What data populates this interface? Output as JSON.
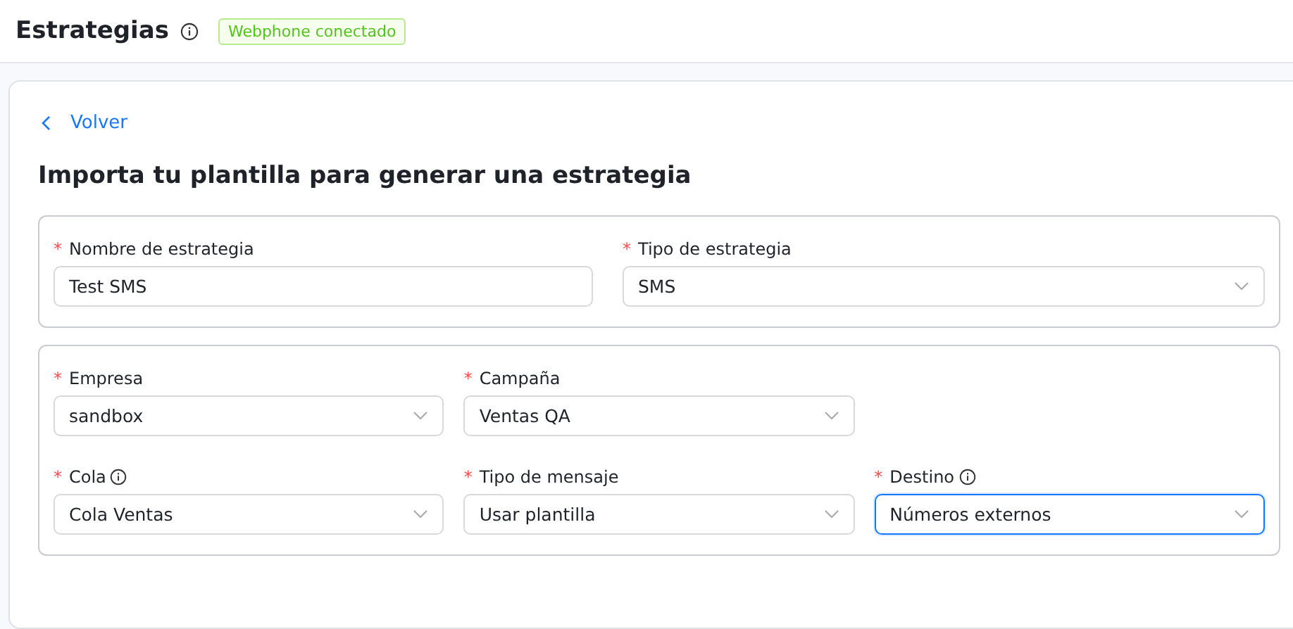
{
  "header": {
    "title": "Estrategias",
    "info": true,
    "badge": "Webphone conectado"
  },
  "back_link": "Volver",
  "heading": "Importa tu plantilla para generar una estrategia",
  "sections": [
    {
      "rows": [
        [
          {
            "label": "Nombre de estrategia",
            "required_mark": "*",
            "info": false,
            "kind": "text",
            "value": "Test SMS",
            "focused": false
          },
          {
            "label": "Tipo de estrategia",
            "required_mark": "*",
            "info": false,
            "kind": "select",
            "value": "SMS",
            "focused": false
          }
        ]
      ]
    },
    {
      "rows": [
        [
          {
            "label": "Empresa",
            "required_mark": "*",
            "info": false,
            "kind": "select",
            "value": "sandbox",
            "focused": false
          },
          {
            "label": "Campaña",
            "required_mark": "*",
            "info": false,
            "kind": "select",
            "value": "Ventas QA",
            "focused": false
          }
        ],
        [
          {
            "label": "Cola",
            "required_mark": "*",
            "info": true,
            "kind": "select",
            "value": "Cola Ventas",
            "focused": false
          },
          {
            "label": "Tipo de mensaje",
            "required_mark": "*",
            "info": false,
            "kind": "select",
            "value": "Usar plantilla",
            "focused": false
          },
          {
            "label": "Destino",
            "required_mark": "*",
            "info": true,
            "kind": "select",
            "value": "Números externos",
            "focused": true
          }
        ]
      ]
    }
  ]
}
